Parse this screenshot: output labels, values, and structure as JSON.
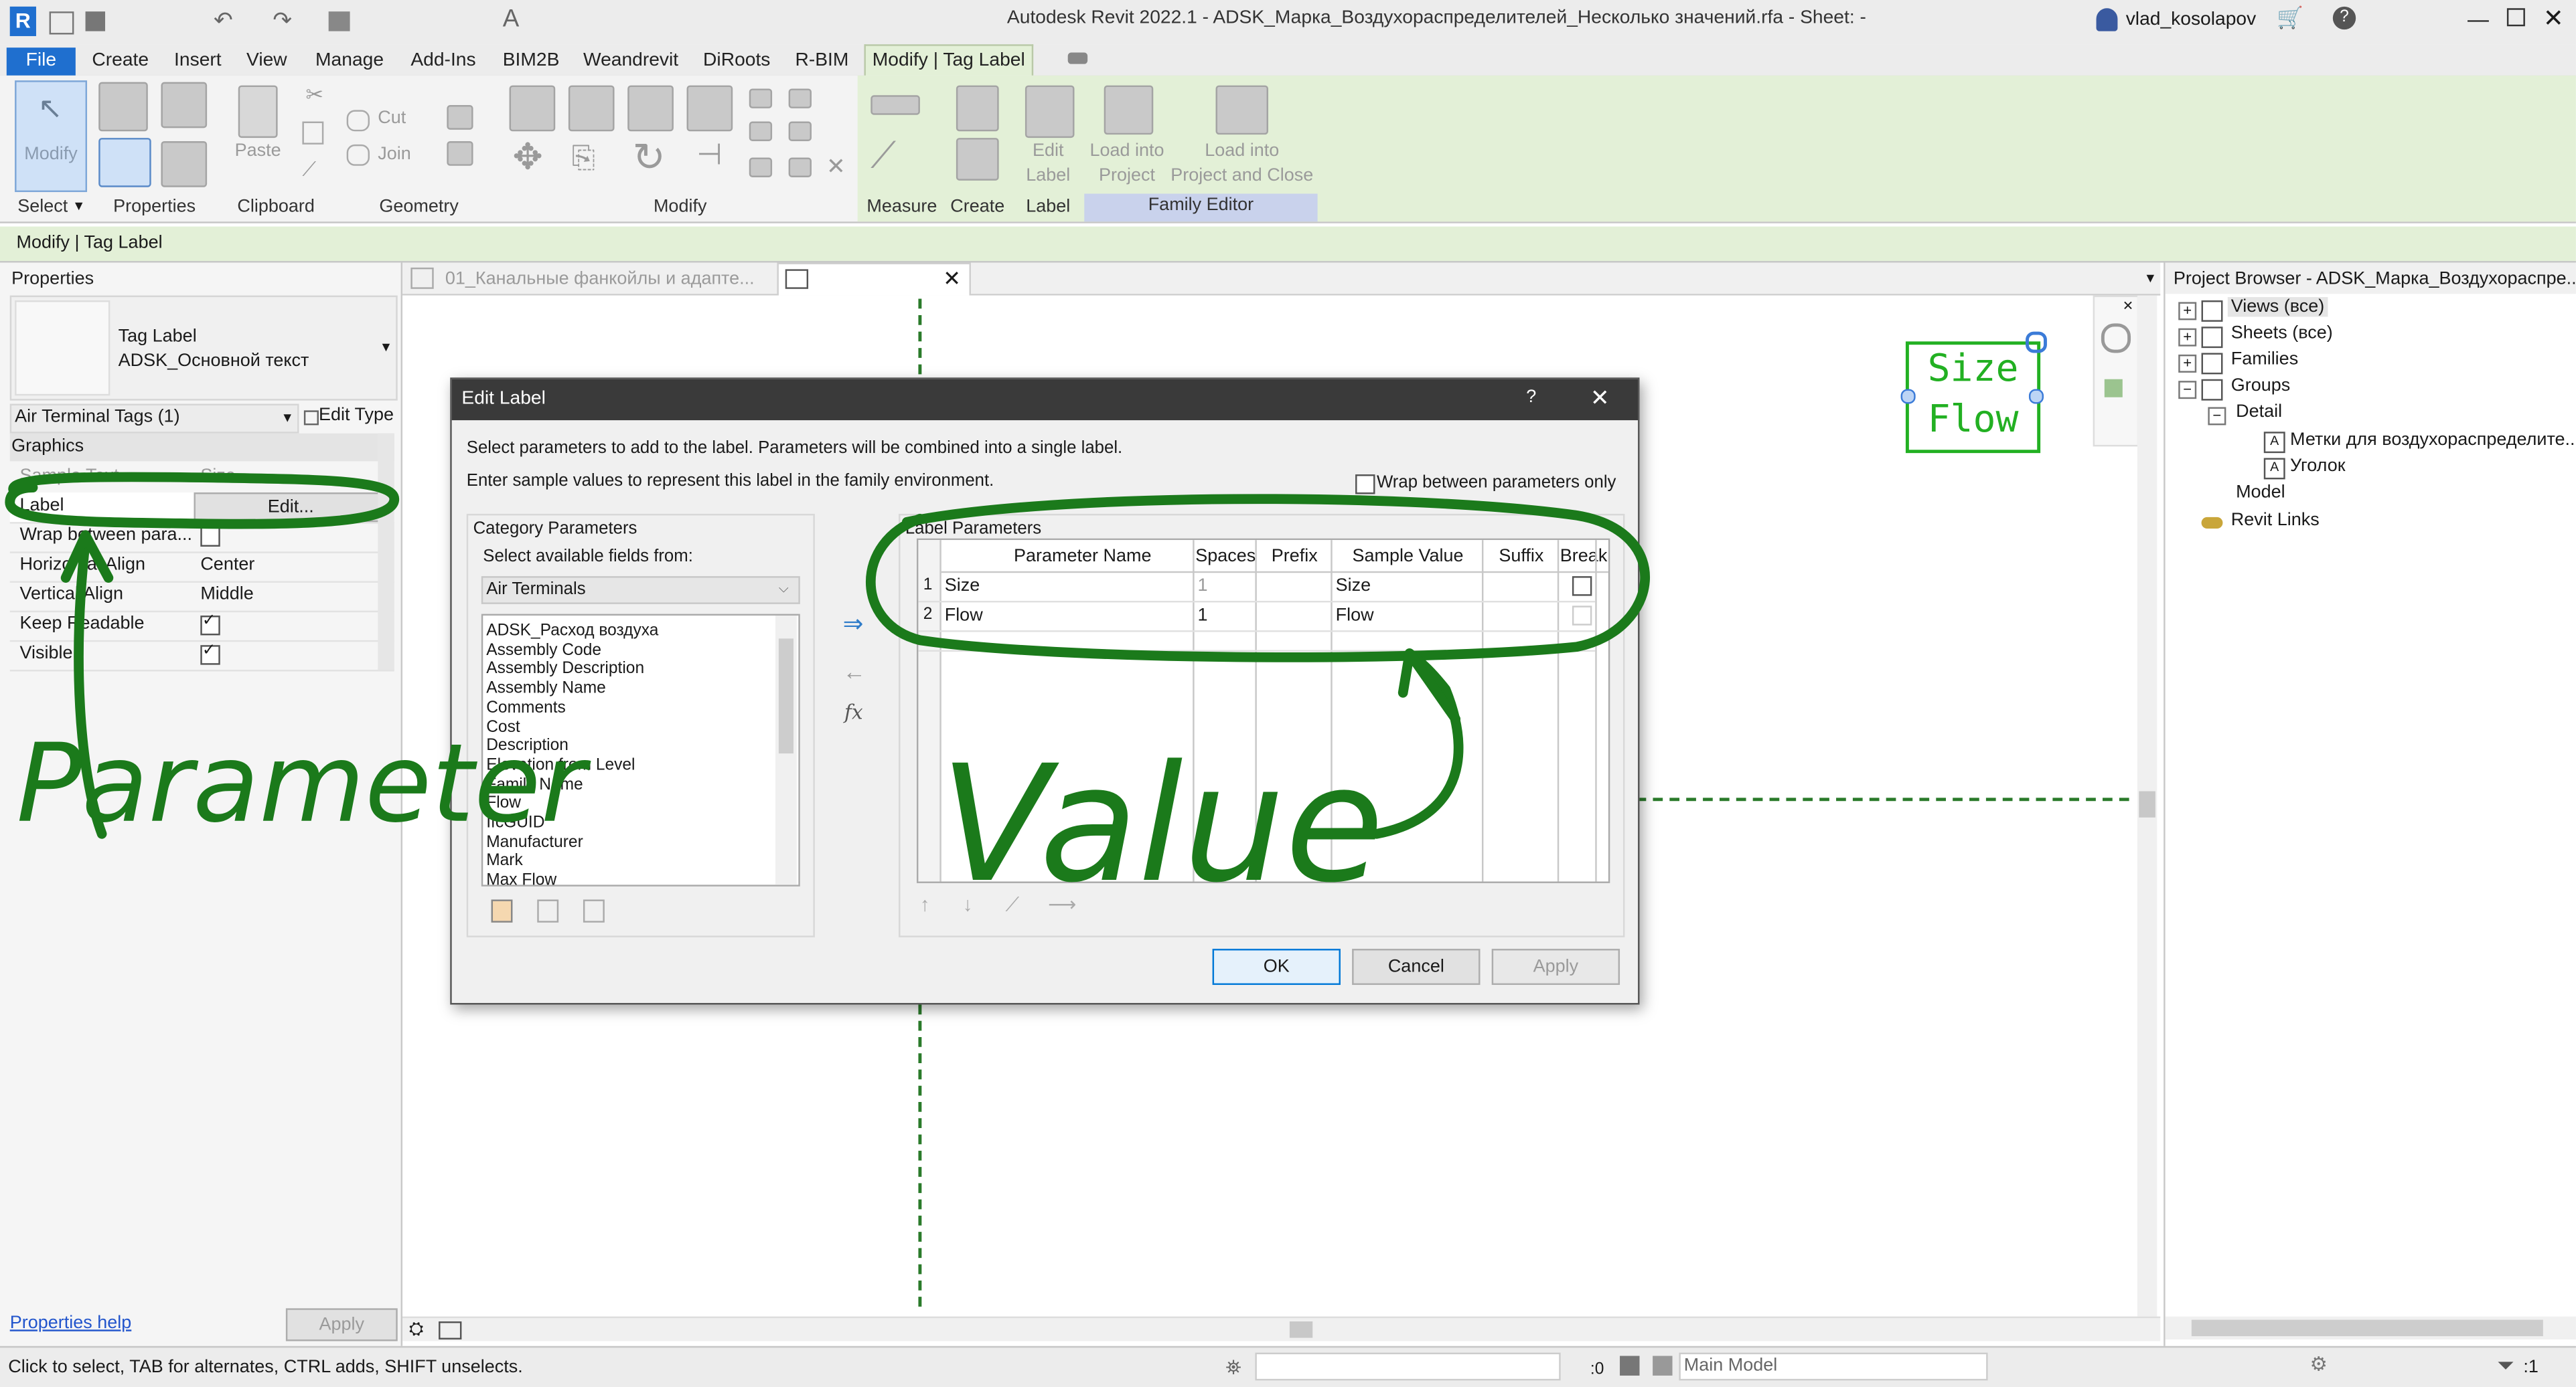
{
  "title_bar": {
    "title": "Autodesk Revit 2022.1 - ADSK_Марка_Воздухораспределителей_Несколько значений.rfa - Sheet: -",
    "user": "vlad_kosolapov"
  },
  "ribbon_tabs": [
    "File",
    "Create",
    "Insert",
    "View",
    "Manage",
    "Add-Ins",
    "BIM2B",
    "Weandrevit",
    "DiRoots",
    "R-BIM",
    "Modify | Tag Label"
  ],
  "ribbon": {
    "modify": "Modify",
    "cut": "Cut",
    "join": "Join",
    "paste": "Paste",
    "edit_label": [
      "Edit",
      "Label"
    ],
    "load_into_project": [
      "Load into",
      "Project"
    ],
    "load_into_project_close": [
      "Load into",
      "Project and Close"
    ],
    "panels": [
      "Select",
      "Properties",
      "Clipboard",
      "Geometry",
      "Modify",
      "Measure",
      "Create",
      "Label",
      "Family Editor"
    ]
  },
  "context_bar": "Modify | Tag Label",
  "view_tabs": [
    "01_Канальные фанкойлы и адапте..."
  ],
  "properties": {
    "header": "Properties",
    "type_name": "Tag Label",
    "type_sub": "ADSK_Основной текст",
    "selector": "Air Terminal Tags (1)",
    "edit_type": "Edit Type",
    "group": "Graphics",
    "rows": [
      {
        "k": "Sample Text",
        "v": "Size..."
      },
      {
        "k": "Label",
        "v": "Edit..."
      },
      {
        "k": "Wrap between para...",
        "v": ""
      },
      {
        "k": "Horizontal Align",
        "v": "Center"
      },
      {
        "k": "Vertical Align",
        "v": "Middle"
      },
      {
        "k": "Keep Readable",
        "v": ""
      },
      {
        "k": "Visible",
        "v": ""
      }
    ],
    "help": "Properties help",
    "apply": "Apply"
  },
  "dialog": {
    "title": "Edit Label",
    "help": "?",
    "intro1": "Select parameters to add to the label.  Parameters will be combined into a single label.",
    "intro2": "Enter sample values to represent this label in the family environment.",
    "wrap_only": "Wrap between parameters only",
    "category_params": "Category Parameters",
    "select_from": "Select available fields from:",
    "category": "Air Terminals",
    "fields": [
      "ADSK_Расход воздуха",
      "Assembly Code",
      "Assembly Description",
      "Assembly Name",
      "Comments",
      "Cost",
      "Description",
      "Elevation from Level",
      "Family Name",
      "Flow",
      "IfcGUID",
      "Manufacturer",
      "Mark",
      "Max Flow"
    ],
    "label_params": "Label Parameters",
    "columns": [
      "Parameter Name",
      "Spaces",
      "Prefix",
      "Sample Value",
      "Suffix",
      "Break"
    ],
    "rows": [
      {
        "n": "1",
        "name": "Size",
        "spaces": "1",
        "prefix": "",
        "sample": "Size",
        "suffix": ""
      },
      {
        "n": "2",
        "name": "Flow",
        "spaces": "1",
        "prefix": "",
        "sample": "Flow",
        "suffix": ""
      }
    ],
    "fx": "fx",
    "ok": "OK",
    "cancel": "Cancel",
    "apply": "Apply"
  },
  "tag_preview": {
    "line1": "Size",
    "line2": "Flow"
  },
  "project_browser": {
    "header": "Project Browser - ADSK_Марка_Воздухораспре...",
    "items": [
      "Views (все)",
      "Sheets (все)",
      "Families",
      "Groups",
      "Detail",
      "Метки для воздухораспределите...",
      "Уголок",
      "Model",
      "Revit Links"
    ]
  },
  "status_bar": {
    "hint": "Click to select, TAB for alternates, CTRL adds, SHIFT unselects.",
    "zero": ":0",
    "model": "Main Model",
    "filter": ":1"
  },
  "annotations": {
    "parameter": "Parameter",
    "value": "Value"
  },
  "colors": {
    "annotation_green": "#1b7a1b",
    "context_green": "#e3f0d7",
    "tag_green": "#22b022",
    "file_blue": "#1f6fcf"
  }
}
